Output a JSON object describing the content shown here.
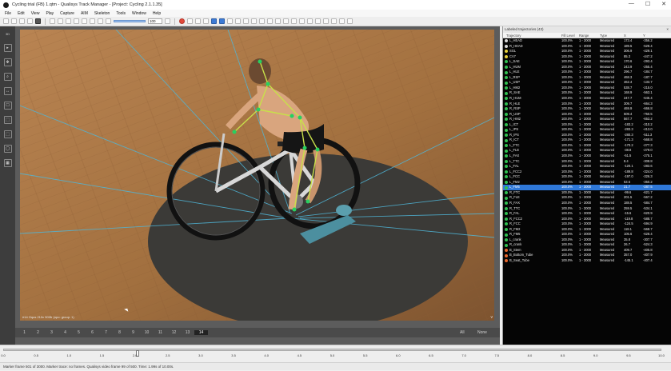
{
  "window": {
    "title": "Cycling trial (FB) 1.qtm - Qualisys Track Manager - [Project: Cycling 2.1.1.35]",
    "controls": [
      "—",
      "☐",
      "✕"
    ]
  },
  "menu": [
    "File",
    "Edit",
    "View",
    "Play",
    "Capture",
    "AIM",
    "Skeleton",
    "Tools",
    "Window",
    "Help"
  ],
  "toolbar": {
    "zoom_value": "100"
  },
  "left_tools": [
    "3D",
    "▸",
    "✥",
    "⌕",
    "↔",
    "☐",
    "⬚",
    "⬚",
    "◯",
    "▦"
  ],
  "video": {
    "caption": "#14 Oqus 210c 500fr (upo: group: 1)",
    "corner_mark": "v"
  },
  "frame_bar": {
    "numbers": [
      "1",
      "2",
      "3",
      "4",
      "5",
      "6",
      "7",
      "8",
      "9",
      "10",
      "11",
      "12",
      "13",
      "14"
    ],
    "active": "14",
    "all_label": "All",
    "none_label": "None"
  },
  "trajectories": {
    "panel_title": "Labeled trajectories (43)",
    "columns": [
      "Trajectory",
      "Fill Level",
      "Range",
      "Type",
      "X",
      "Y"
    ],
    "rows": [
      {
        "name": "L_HEAD",
        "fill": "100.0%",
        "range": "1 - 3000",
        "type": "Measured",
        "x": "173.4",
        "y": "-356.2",
        "color": "#d9d9d9"
      },
      {
        "name": "R_HEAD",
        "fill": "100.0%",
        "range": "1 - 3000",
        "type": "Measured",
        "x": "189.5",
        "y": "-528.4",
        "color": "#d9d9d9"
      },
      {
        "name": "SGL",
        "fill": "100.0%",
        "range": "1 - 3000",
        "type": "Measured",
        "x": "306.9",
        "y": "-429.1",
        "color": "#e8d13a"
      },
      {
        "name": "CV7",
        "fill": "100.0%",
        "range": "1 - 3000",
        "type": "Measured",
        "x": "85.3",
        "y": "-447.2",
        "color": "#e8d13a"
      },
      {
        "name": "L_SAE",
        "fill": "100.0%",
        "range": "1 - 3000",
        "type": "Measured",
        "x": "170.6",
        "-": "",
        "y": "-293.4",
        "color": "#2fbf4f"
      },
      {
        "name": "L_HUM",
        "fill": "100.0%",
        "range": "1 - 3000",
        "type": "Measured",
        "x": "243.9",
        "y": "-255.4",
        "color": "#2fbf4f"
      },
      {
        "name": "L_HLE",
        "fill": "100.0%",
        "range": "1 - 3000",
        "type": "Measured",
        "x": "296.7",
        "y": "-184.7",
        "color": "#2fbf4f"
      },
      {
        "name": "L_RSP",
        "fill": "100.0%",
        "range": "1 - 3000",
        "type": "Measured",
        "x": "468.3",
        "y": "-187.7",
        "color": "#2fbf4f"
      },
      {
        "name": "L_USP",
        "fill": "100.0%",
        "range": "1 - 3000",
        "type": "Measured",
        "x": "462.4",
        "y": "-133.7",
        "color": "#2fbf4f"
      },
      {
        "name": "L_HM2",
        "fill": "100.0%",
        "range": "1 - 3000",
        "type": "Measured",
        "x": "538.7",
        "y": "-215.0",
        "color": "#2fbf4f"
      },
      {
        "name": "R_SAE",
        "fill": "100.0%",
        "range": "1 - 3000",
        "type": "Measured",
        "x": "168.9",
        "y": "-563.1",
        "color": "#2fbf4f"
      },
      {
        "name": "R_HUM",
        "fill": "100.0%",
        "range": "1 - 3000",
        "type": "Measured",
        "x": "247.7",
        "y": "-645.4",
        "color": "#2fbf4f"
      },
      {
        "name": "R_HLE",
        "fill": "100.0%",
        "range": "1 - 3000",
        "type": "Measured",
        "x": "309.7",
        "y": "-664.3",
        "color": "#2fbf4f"
      },
      {
        "name": "R_RSP",
        "fill": "100.0%",
        "range": "1 - 3000",
        "type": "Measured",
        "x": "469.9",
        "y": "-666.8",
        "color": "#2fbf4f"
      },
      {
        "name": "R_USP",
        "fill": "100.0%",
        "range": "1 - 3000",
        "type": "Measured",
        "x": "509.4",
        "y": "-750.5",
        "color": "#2fbf4f"
      },
      {
        "name": "R_HM2",
        "fill": "100.0%",
        "range": "1 - 3000",
        "type": "Measured",
        "x": "567.7",
        "y": "-653.2",
        "color": "#2fbf4f"
      },
      {
        "name": "L_ICT",
        "fill": "100.0%",
        "range": "1 - 3000",
        "type": "Measured",
        "x": "-183.2",
        "y": "-310.2",
        "color": "#2fbf4f"
      },
      {
        "name": "L_IPS",
        "fill": "100.0%",
        "range": "1 - 3000",
        "type": "Measured",
        "x": "-283.3",
        "y": "-413.0",
        "color": "#2fbf4f"
      },
      {
        "name": "R_IPS",
        "fill": "100.0%",
        "range": "1 - 3000",
        "type": "Measured",
        "x": "-280.3",
        "y": "-511.3",
        "color": "#2fbf4f"
      },
      {
        "name": "R_ICT",
        "fill": "100.0%",
        "range": "1 - 3000",
        "type": "Measured",
        "x": "-171.3",
        "y": "-568.8",
        "color": "#2fbf4f"
      },
      {
        "name": "L_FTC",
        "fill": "100.0%",
        "range": "1 - 3000",
        "type": "Measured",
        "x": "-170.2",
        "y": "-277.3",
        "color": "#2fbf4f"
      },
      {
        "name": "L_FLE",
        "fill": "100.0%",
        "range": "1 - 3000",
        "type": "Measured",
        "x": "-38.8",
        "y": "-279.0",
        "color": "#2fbf4f"
      },
      {
        "name": "L_FAX",
        "fill": "100.0%",
        "range": "1 - 3000",
        "type": "Measured",
        "x": "-51.5",
        "y": "-275.1",
        "color": "#2fbf4f"
      },
      {
        "name": "L_TTC",
        "fill": "100.0%",
        "range": "1 - 3000",
        "type": "Measured",
        "x": "8.4",
        "y": "-308.8",
        "color": "#2fbf4f"
      },
      {
        "name": "L_FAL",
        "fill": "100.0%",
        "range": "1 - 3000",
        "type": "Measured",
        "x": "-120.1",
        "y": "-283.6",
        "color": "#2fbf4f"
      },
      {
        "name": "L_FCC2",
        "fill": "100.0%",
        "range": "1 - 3000",
        "type": "Measured",
        "x": "-189.8",
        "y": "-324.0",
        "color": "#2fbf4f"
      },
      {
        "name": "L_FCC",
        "fill": "100.0%",
        "range": "1 - 3000",
        "type": "Measured",
        "x": "-197.0",
        "y": "-326.3",
        "color": "#2fbf4f"
      },
      {
        "name": "L_FM2",
        "fill": "100.0%",
        "range": "1 - 3000",
        "type": "Measured",
        "x": "53.6",
        "y": "-350.2",
        "color": "#2fbf4f"
      },
      {
        "name": "L_FM5",
        "fill": "100.0%",
        "range": "1 - 3000",
        "type": "Measured",
        "x": "21.7",
        "y": "-287.5",
        "color": "#2fbf4f",
        "selected": true
      },
      {
        "name": "R_FTC",
        "fill": "100.0%",
        "range": "1 - 3000",
        "type": "Measured",
        "x": "-99.6",
        "y": "-621.7",
        "color": "#2fbf4f"
      },
      {
        "name": "R_FLE",
        "fill": "100.0%",
        "range": "1 - 3000",
        "type": "Measured",
        "x": "201.5",
        "y": "-567.2",
        "color": "#2fbf4f"
      },
      {
        "name": "R_FAX",
        "fill": "100.0%",
        "range": "1 - 3000",
        "type": "Measured",
        "x": "188.5",
        "y": "-584.7",
        "color": "#2fbf4f"
      },
      {
        "name": "R_TTC",
        "fill": "100.0%",
        "range": "1 - 3000",
        "type": "Measured",
        "x": "259.5",
        "y": "-534.1",
        "color": "#2fbf4f"
      },
      {
        "name": "R_FAL",
        "fill": "100.0%",
        "range": "1 - 3000",
        "type": "Measured",
        "x": "-15.6",
        "y": "-620.9",
        "color": "#2fbf4f"
      },
      {
        "name": "R_FCC2",
        "fill": "100.0%",
        "range": "1 - 3000",
        "type": "Measured",
        "x": "-119.8",
        "y": "-588.7",
        "color": "#2fbf4f"
      },
      {
        "name": "R_FCC",
        "fill": "100.0%",
        "range": "1 - 3000",
        "type": "Measured",
        "x": "-124.5",
        "y": "-594.9",
        "color": "#2fbf4f"
      },
      {
        "name": "R_FM2",
        "fill": "100.0%",
        "range": "1 - 3000",
        "type": "Measured",
        "x": "118.1",
        "y": "-568.7",
        "color": "#2fbf4f"
      },
      {
        "name": "R_FM5",
        "fill": "100.0%",
        "range": "1 - 3000",
        "type": "Measured",
        "x": "105.6",
        "y": "-628.4",
        "color": "#2fbf4f"
      },
      {
        "name": "L_crank",
        "fill": "100.0%",
        "range": "1 - 3000",
        "type": "Measured",
        "x": "35.8",
        "y": "-307.7",
        "color": "#2fbf4f"
      },
      {
        "name": "R_crank",
        "fill": "100.0%",
        "range": "1 - 3000",
        "type": "Measured",
        "x": "26.7",
        "y": "-524.3",
        "color": "#2fbf4f"
      },
      {
        "name": "B_Stem",
        "fill": "100.0%",
        "range": "1 - 3000",
        "type": "Measured",
        "x": "409.7",
        "y": "-405.8",
        "color": "#e8662a"
      },
      {
        "name": "B_Bottom_Tube",
        "fill": "100.0%",
        "range": "1 - 3000",
        "type": "Measured",
        "x": "357.0",
        "y": "-407.9",
        "color": "#e8662a"
      },
      {
        "name": "B_Seat_Tube",
        "fill": "100.0%",
        "range": "1 - 3000",
        "type": "Measured",
        "x": "-145.1",
        "y": "-407.4",
        "color": "#e8662a"
      }
    ]
  },
  "timeline": {
    "position": 0.2,
    "tick_labels": [
      "0.0",
      "0.5",
      "1.0",
      "1.5",
      "2.0",
      "2.5",
      "3.0",
      "3.5",
      "4.0",
      "4.5",
      "5.0",
      "5.5",
      "6.0",
      "6.5",
      "7.0",
      "7.5",
      "8.0",
      "8.5",
      "9.0",
      "9.5",
      "10.0"
    ]
  },
  "status": "Marker frame 501 of 3000. Marker trace: no frames. Qualisys video frame 99 of 500. Time: 1.99s of 10.00s."
}
